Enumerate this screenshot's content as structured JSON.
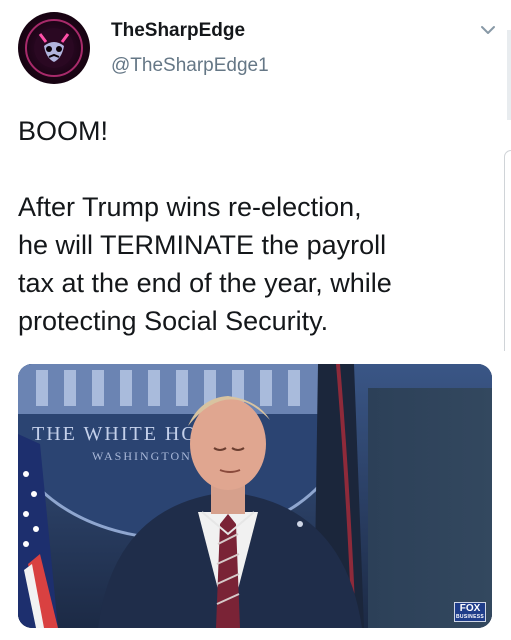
{
  "author": {
    "display_name": "TheSharpEdge",
    "handle": "@TheSharpEdge1",
    "avatar_icon": "devil-mask-avatar"
  },
  "tweet": {
    "text": "BOOM!\n\nAfter Trump wins re-election,\nhe will TERMINATE the payroll\ntax at the end of the year, while\nprotecting Social Security."
  },
  "media": {
    "backdrop_line1": "THE WHITE HO",
    "backdrop_line2": "WASHINGTON",
    "network_logo": "FOX",
    "network_logo_sub": "BUSINESS"
  },
  "icons": {
    "menu": "chevron-down-icon"
  },
  "colors": {
    "text_primary": "#14171a",
    "text_secondary": "#657786",
    "backdrop_blue": "#233454"
  }
}
